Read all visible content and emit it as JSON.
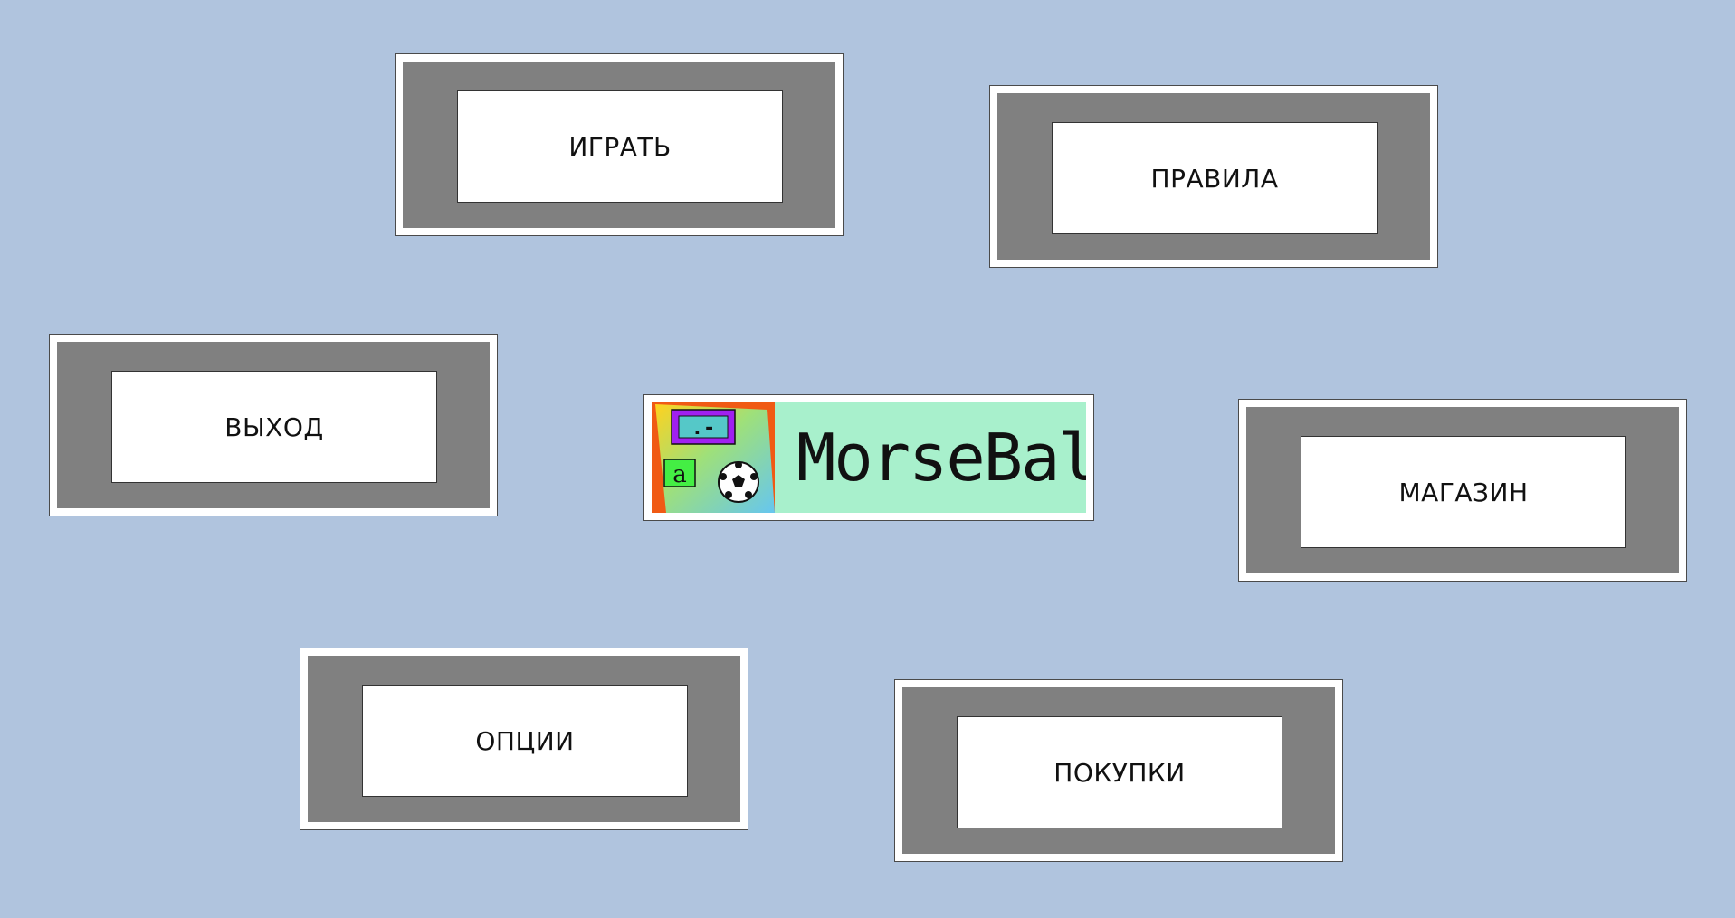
{
  "menu": {
    "play_label": "ИГРАТЬ",
    "rules_label": "ПРАВИЛА",
    "exit_label": "ВЫХОД",
    "shop_label": "МАГАЗИН",
    "options_label": "ОПЦИИ",
    "purchases_label": "ПОКУПКИ"
  },
  "logo": {
    "title": "MorseBall",
    "morse_code": ".-",
    "letter": "a"
  },
  "colors": {
    "background": "#b0c4de",
    "button_frame": "#808080",
    "button_face": "#ffffff",
    "logo_background": "#a8f0cc",
    "emblem_orange": "#f05a14",
    "emblem_purple": "#a020f0",
    "emblem_green": "#44ee44"
  },
  "icons": [
    "morse-sign-icon",
    "letter-tile-icon",
    "soccer-ball-icon"
  ]
}
